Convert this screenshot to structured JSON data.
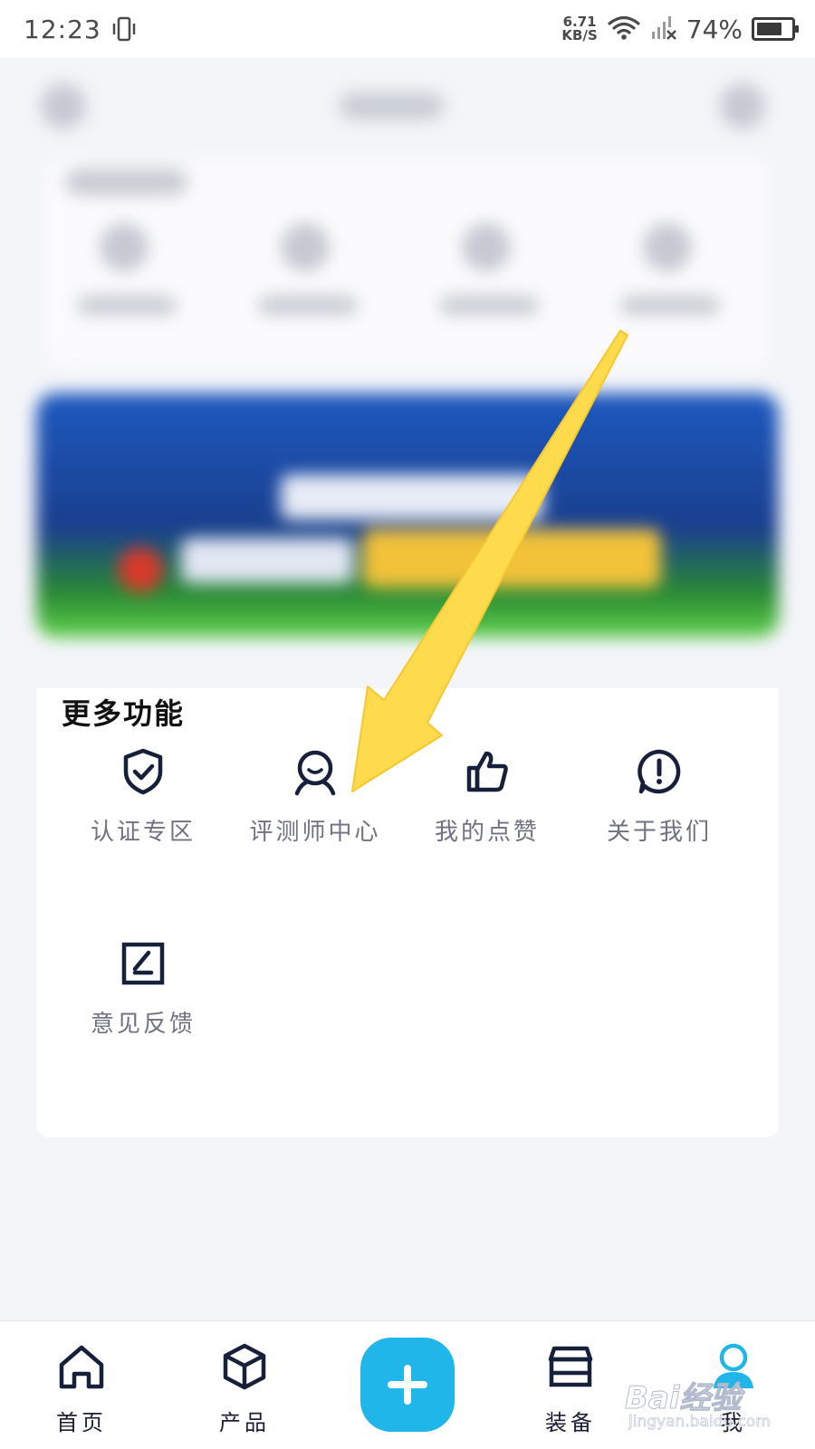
{
  "status_bar": {
    "time": "12:23",
    "net_speed_value": "6.71",
    "net_speed_unit": "KB/S",
    "battery_percent": "74%",
    "battery_level": 0.74,
    "icons": [
      "vibrate-icon",
      "wifi-icon",
      "signal-no-sim-icon",
      "battery-icon"
    ]
  },
  "more_functions": {
    "title": "更多功能",
    "items": [
      {
        "label": "认证专区",
        "icon": "shield-check-icon"
      },
      {
        "label": "评测师中心",
        "icon": "reviewer-avatar-icon"
      },
      {
        "label": "我的点赞",
        "icon": "thumbs-up-icon"
      },
      {
        "label": "关于我们",
        "icon": "info-exclamation-icon"
      },
      {
        "label": "意见反馈",
        "icon": "feedback-edit-icon"
      }
    ]
  },
  "bottom_nav": {
    "items": [
      {
        "label": "首页",
        "icon": "home-icon"
      },
      {
        "label": "产品",
        "icon": "box-icon"
      },
      {
        "label": "",
        "icon": "plus-icon"
      },
      {
        "label": "装备",
        "icon": "equipment-box-icon"
      },
      {
        "label": "我",
        "icon": "user-icon",
        "active": true
      }
    ]
  },
  "annotation": {
    "arrow_color": "#fddb4c",
    "points_to": "评测师中心"
  },
  "watermark": {
    "logo": "Bai经验",
    "url": "jingyan.baidu.com"
  },
  "colors": {
    "accent": "#21b6ea",
    "icon_dark": "#17203a",
    "label_gray": "#6f7280",
    "background": "#f4f5f9"
  }
}
